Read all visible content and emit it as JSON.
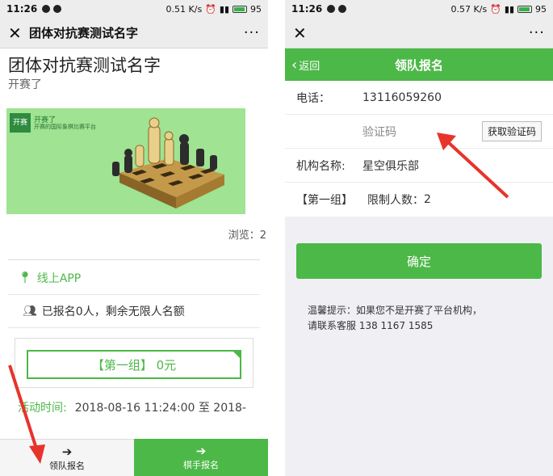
{
  "status": {
    "left": {
      "time": "11:26",
      "net": "0.51 K/s",
      "battery": "95"
    },
    "right": {
      "time": "11:26",
      "net": "0.57 K/s",
      "battery": "95"
    }
  },
  "left_page": {
    "nav_title": "团体对抗赛测试名字",
    "title": "团体对抗赛测试名字",
    "subtitle": "开赛了",
    "banner": {
      "logo": "开赛",
      "brand": "开赛了",
      "brand_sub": "开赛的国际象棋比赛平台"
    },
    "views": "浏览：2",
    "online": "线上APP",
    "signed": "已报名0人，剩余无限人名额",
    "group_button": "【第一组】 0元",
    "activity_label": "活动时间:",
    "activity_value": "2018-08-16 11:24:00 至 2018-",
    "bottom": {
      "leader_signup": "领队报名",
      "player_signup": "棋手报名"
    }
  },
  "right_page": {
    "back_label": "返回",
    "header_title": "领队报名",
    "phone_label": "电话：",
    "phone_value": "13116059260",
    "code_placeholder": "验证码",
    "code_button": "获取验证码",
    "org_label": "机构名称:",
    "org_value": "星空俱乐部",
    "group_label": "【第一组】",
    "limit_label": "限制人数：",
    "limit_value": "2",
    "confirm": "确定",
    "tip_line1": "温馨提示：如果您不是开赛了平台机构，",
    "tip_line2": "请联系客服 138 1167 1585"
  },
  "colors": {
    "accent": "#4cb848",
    "arrow": "#e8332b"
  },
  "icons": [
    "close-icon",
    "more-icon",
    "location-icon",
    "users-icon",
    "signin-icon",
    "back-chevron-icon"
  ]
}
